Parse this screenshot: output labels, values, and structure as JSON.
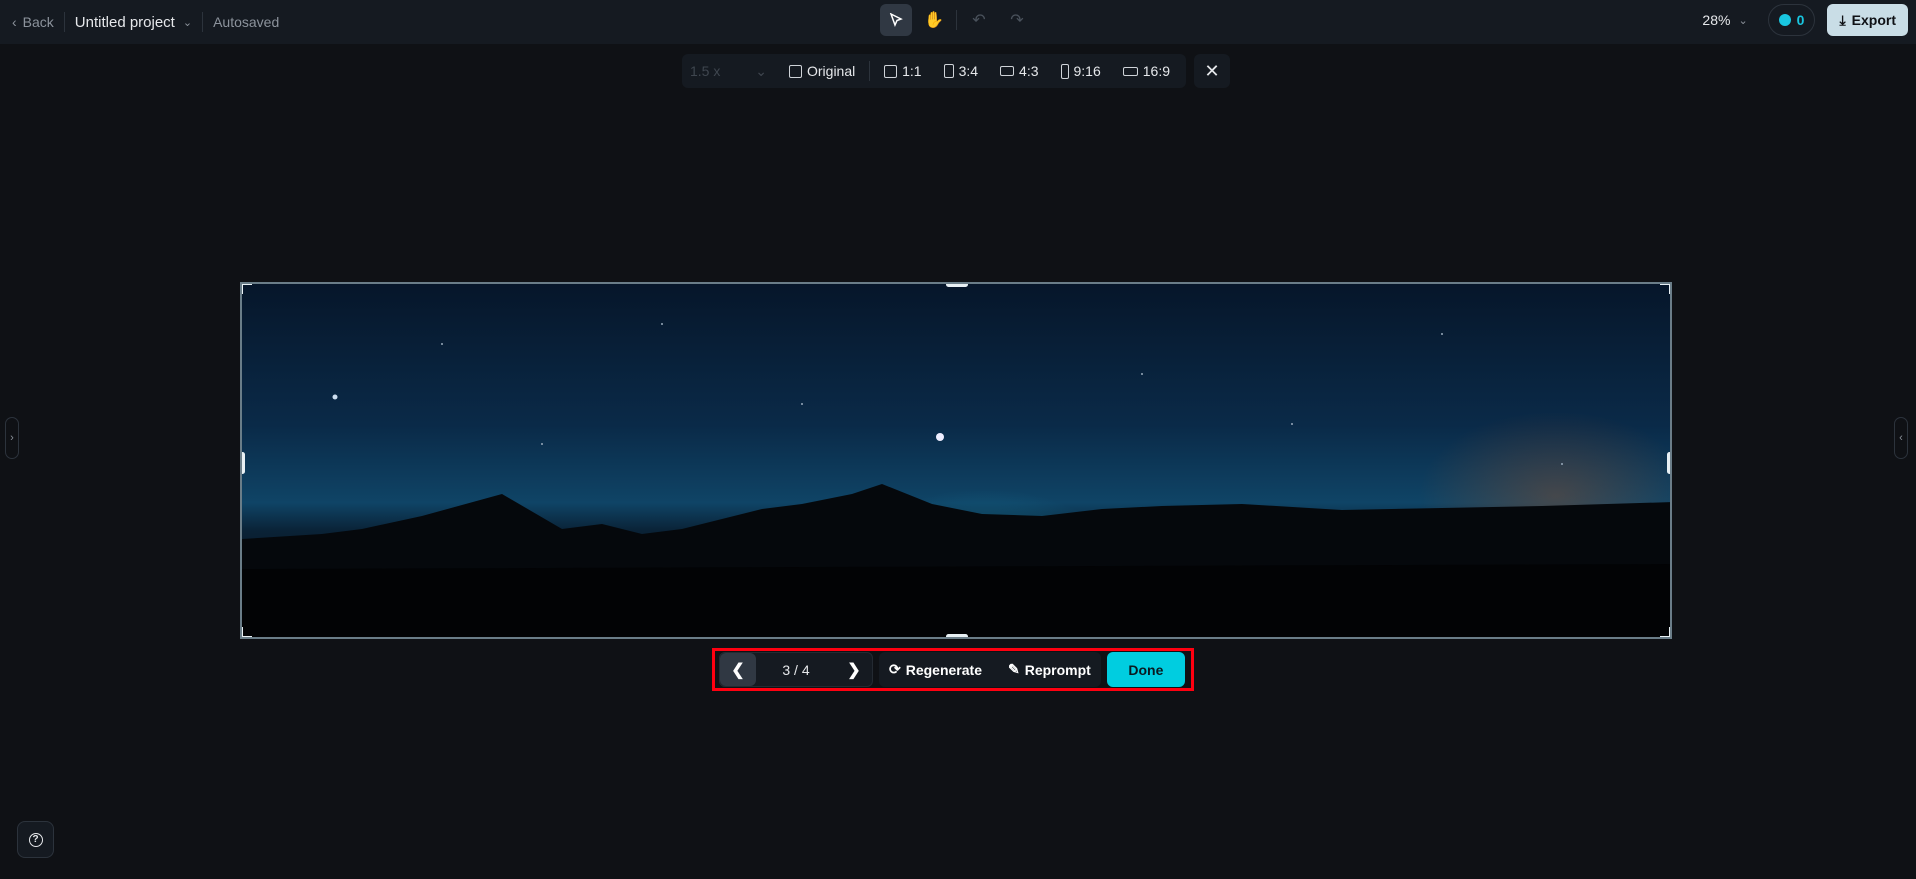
{
  "topbar": {
    "back": "Back",
    "project_name": "Untitled project",
    "status": "Autosaved",
    "zoom": "28%",
    "credits": "0",
    "export": "Export"
  },
  "ratio_toolbar": {
    "scale": "1.5 x",
    "options": [
      "Original",
      "1:1",
      "3:4",
      "4:3",
      "9:16",
      "16:9"
    ]
  },
  "actions": {
    "counter": "3 / 4",
    "regenerate": "Regenerate",
    "reprompt": "Reprompt",
    "done": "Done"
  },
  "colors": {
    "accent": "#00cde0",
    "highlight": "#ff0010",
    "export_bg": "#c9dde6"
  }
}
